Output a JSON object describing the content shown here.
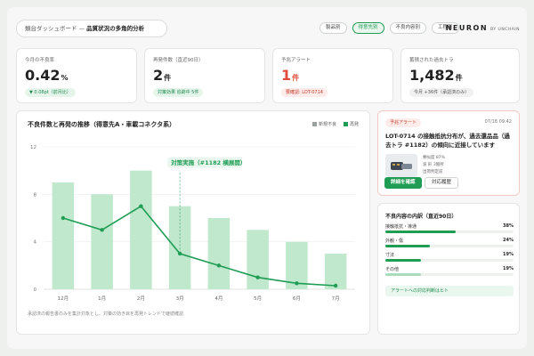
{
  "header": {
    "title_prefix": "類台ダッシュボード — ",
    "title_main": "品質状況の多角的分析",
    "tabs": [
      "製品別",
      "得意先別",
      "不良内容別",
      "工程別"
    ],
    "active_tab": 1,
    "logo": "NEURON",
    "logo_sub": "BY UNCHAIN"
  },
  "kpis": [
    {
      "label": "今月の不良率",
      "value": "0.42",
      "unit": "%",
      "sub": "▼ 0.08pt（前月比）",
      "sub_style": "green",
      "value_style": ""
    },
    {
      "label": "再発件数（直近90日）",
      "value": "2",
      "unit": "件",
      "sub": "対策効果 追跡中 5件",
      "sub_style": "green",
      "value_style": ""
    },
    {
      "label": "予兆アラート",
      "value": "1",
      "unit": "件",
      "sub": "要確認: LOT-0714",
      "sub_style": "red",
      "value_style": "red"
    },
    {
      "label": "蓄積された過去トラ",
      "value": "1,482",
      "unit": "件",
      "sub": "今月 +36件（承認済のみ）",
      "sub_style": "gray",
      "value_style": ""
    }
  ],
  "chart": {
    "title": "不良件数と再発の推移（得意先A・車載コネクタ系）",
    "legend": [
      "新規不良",
      "再発"
    ],
    "annotation": "対策実施（#1182 横展開）",
    "footnote": "承認済の報告書のみを集計対象とし、対策の効き目を再発トレンドで継続確認"
  },
  "chart_data": {
    "type": "bar",
    "categories": [
      "12月",
      "1月",
      "2月",
      "3月",
      "4月",
      "5月",
      "6月",
      "7月"
    ],
    "series": [
      {
        "name": "新規不良",
        "type": "bar",
        "values": [
          9,
          8,
          10,
          7,
          6,
          5,
          4,
          3
        ]
      },
      {
        "name": "再発",
        "type": "line",
        "values": [
          6,
          5,
          7,
          3,
          2,
          1,
          0.5,
          0.3
        ]
      }
    ],
    "ylim": [
      0,
      12
    ],
    "yticks": [
      0,
      4,
      8,
      12
    ],
    "grid": true,
    "legend_position": "top-right",
    "colors": {
      "bar": "#bfe8cd",
      "line": "#1f9d55"
    }
  },
  "alert": {
    "badge": "予兆アラート",
    "time": "07/18 09:42",
    "title": "LOT-0714 の接触抵抗分布が、過去還品品（過去トラ #1182）の傾向に近接しています",
    "meta": [
      "類似度 87%",
      "波 形 3箇所",
      "出荷判定前"
    ],
    "primary_button": "詳細を確認",
    "secondary_button": "対応履歴"
  },
  "breakdown": {
    "title": "不良内容の内訳（直近90日）",
    "items": [
      {
        "name": "接触抵抗・導通",
        "percent": "38%",
        "level": 0.38
      },
      {
        "name": "外観・傷",
        "percent": "24%",
        "level": 0.24
      },
      {
        "name": "寸法",
        "percent": "19%",
        "level": 0.19
      },
      {
        "name": "その他",
        "percent": "19%",
        "level": 0.19
      }
    ],
    "link": "アラートへの対応判断はヒト"
  }
}
